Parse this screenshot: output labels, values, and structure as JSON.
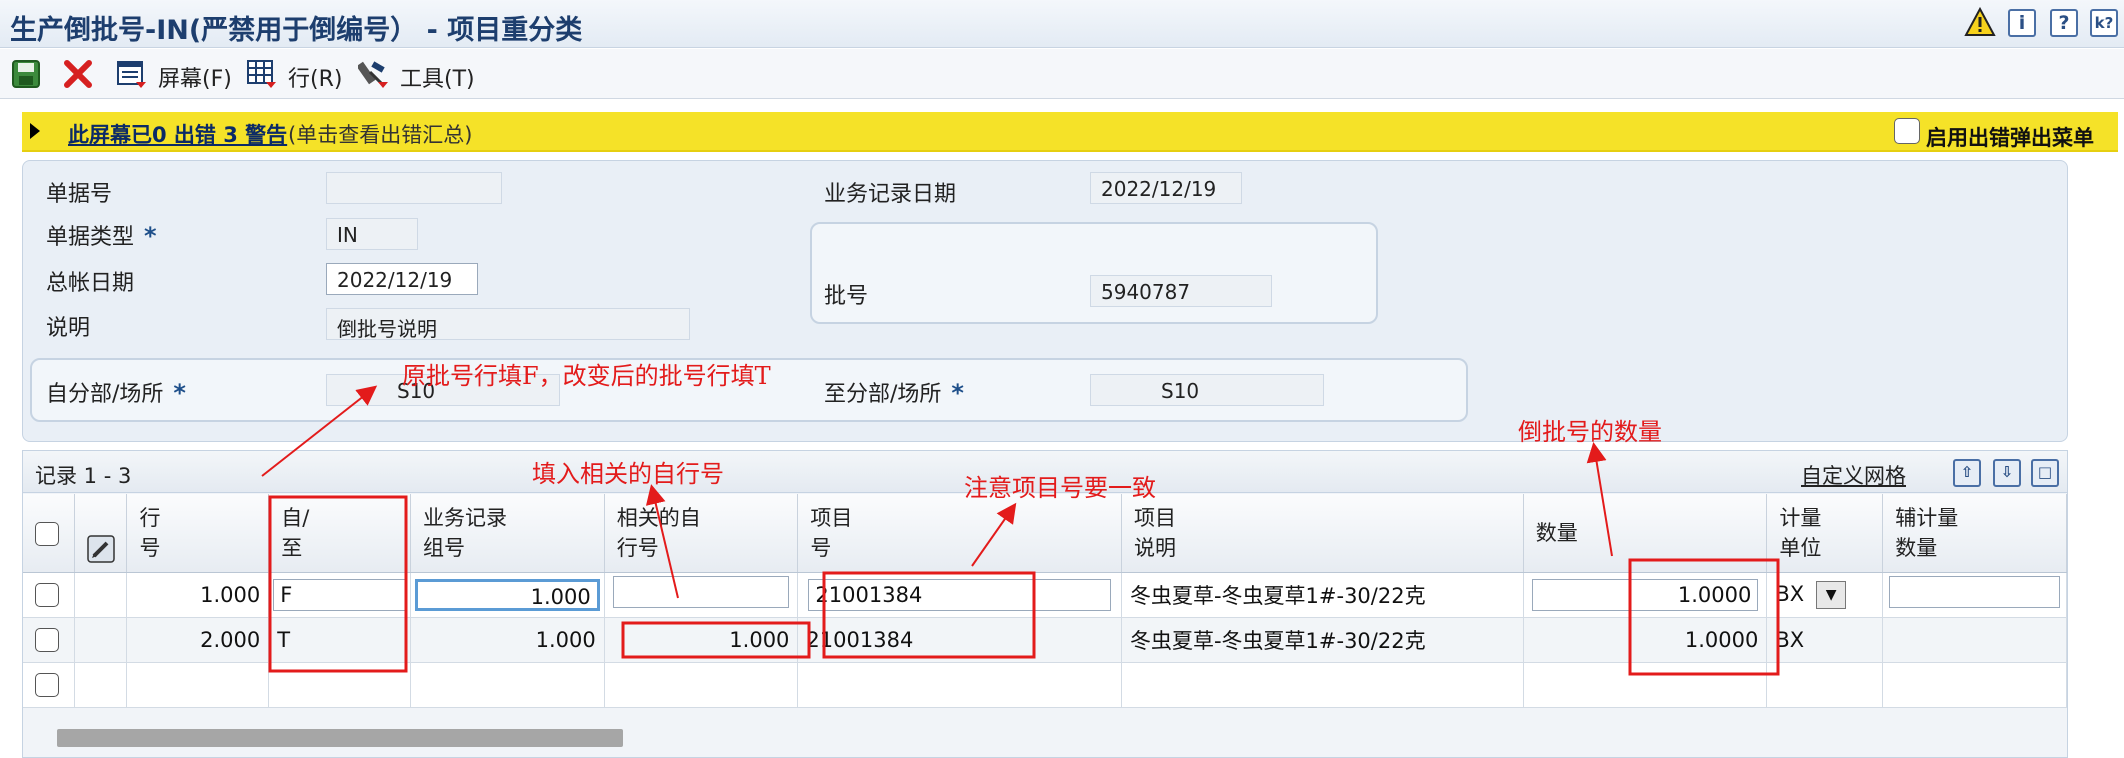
{
  "window": {
    "title": "生产倒批号-IN(严禁用于倒编号） - 项目重分类",
    "icons": [
      "warning-icon",
      "info-icon",
      "help-icon",
      "context-help-icon"
    ]
  },
  "toolbar": {
    "screen_label": "屏幕(F)",
    "row_label": "行(R)",
    "tools_label": "工具(T)"
  },
  "warning_bar": {
    "link_text": "此屏幕已0 出错 3 警告",
    "hint_text": "(单击查看出错汇总)",
    "checkbox_label": "启用出错弹出菜单",
    "checkbox_checked": false
  },
  "form": {
    "doc_no_label": "单据号",
    "doc_no_value": "",
    "doc_type_label": "单据类型",
    "doc_type_value": "IN",
    "gl_date_label": "总帐日期",
    "gl_date_value": "2022/12/19",
    "desc_label": "说明",
    "desc_value": "倒批号说明",
    "trans_date_label": "业务记录日期",
    "trans_date_value": "2022/12/19",
    "lot_label": "批号",
    "lot_value": "5940787",
    "from_branch_label": "自分部/场所",
    "from_branch_value": "S10",
    "to_branch_label": "至分部/场所",
    "to_branch_value": "S10",
    "required_marker": "*"
  },
  "grid": {
    "records": "记录 1 - 3",
    "customize": "自定义网格",
    "columns": [
      "行\n号",
      "自/\n至",
      "业务记录\n组号",
      "相关的自\n行号",
      "项目\n号",
      "项目\n说明",
      "数量",
      "计量\n单位",
      "辅计量\n数量"
    ],
    "rows": [
      {
        "line": "1.000",
        "from_to": "F",
        "group": "1.000",
        "related": "",
        "item": "21001384",
        "desc": "冬虫夏草-冬虫夏草1#-30/22克",
        "qty": "1.0000",
        "uom": "BX",
        "sec_qty": ""
      },
      {
        "line": "2.000",
        "from_to": "T",
        "group": "1.000",
        "related": "1.000",
        "item": "21001384",
        "desc": "冬虫夏草-冬虫夏草1#-30/22克",
        "qty": "1.0000",
        "uom": "BX",
        "sec_qty": ""
      }
    ]
  },
  "annotations": {
    "a1": "原批号行填F，改变后的批号行填T",
    "a2": "填入相关的自行号",
    "a3": "注意项目号要一致",
    "a4": "倒批号的数量",
    "color": "#e31b1b"
  }
}
